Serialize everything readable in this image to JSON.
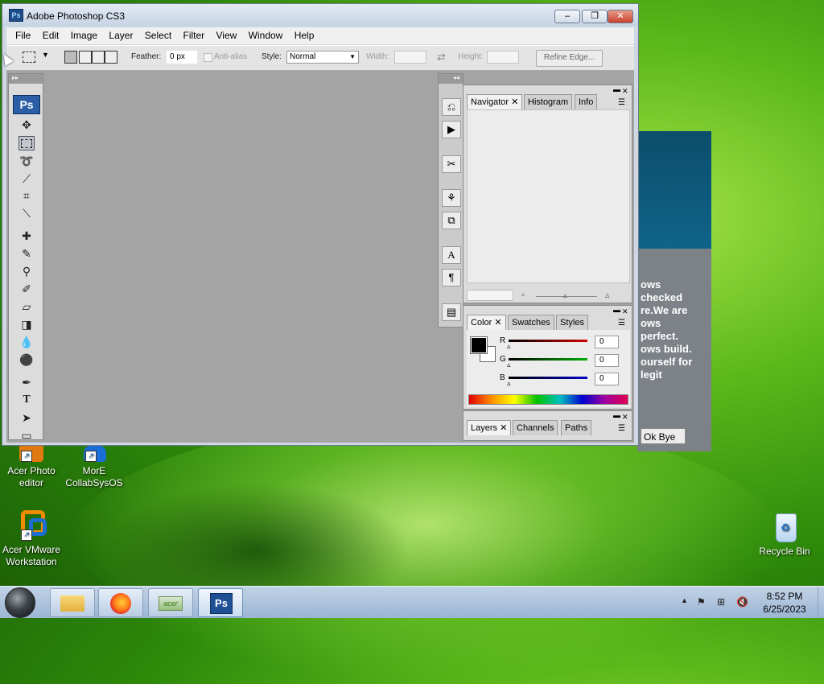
{
  "desktop": {
    "icons": [
      {
        "label_line1": "Acer Photo",
        "label_line2": "editor"
      },
      {
        "label_line1": "MorE",
        "label_line2": "CollabSysOS"
      },
      {
        "label_line1": "Acer VMware",
        "label_line2": "Workstation"
      },
      {
        "label_line1": "Recycle Bin",
        "label_line2": ""
      }
    ]
  },
  "background_dialog": {
    "text_lines": [
      "ows",
      "checked",
      "re.We are",
      "ows",
      "perfect.",
      "ows build.",
      "ourself for",
      "legit"
    ],
    "ok_button": "Ok Bye"
  },
  "photoshop": {
    "title": "Adobe Photoshop CS3",
    "logo": "Ps",
    "menu": [
      "File",
      "Edit",
      "Image",
      "Layer",
      "Select",
      "Filter",
      "View",
      "Window",
      "Help"
    ],
    "options": {
      "feather_label": "Feather:",
      "feather_value": "0 px",
      "antialias_label": "Anti-alias",
      "style_label": "Style:",
      "style_value": "Normal",
      "width_label": "Width:",
      "height_label": "Height:",
      "refine_edge": "Refine Edge..."
    },
    "navigator_panel": {
      "tabs": [
        "Navigator",
        "Histogram",
        "Info"
      ]
    },
    "color_panel": {
      "tabs": [
        "Color",
        "Swatches",
        "Styles"
      ],
      "channels": [
        {
          "label": "R",
          "value": "0",
          "color": "#d40000"
        },
        {
          "label": "G",
          "value": "0",
          "color": "#00b000"
        },
        {
          "label": "B",
          "value": "0",
          "color": "#0000c8"
        }
      ]
    },
    "layers_panel": {
      "tabs": [
        "Layers",
        "Channels",
        "Paths"
      ]
    }
  },
  "taskbar": {
    "ps_label": "Ps",
    "acer_label": "acer",
    "time": "8:52 PM",
    "date": "6/25/2023"
  }
}
